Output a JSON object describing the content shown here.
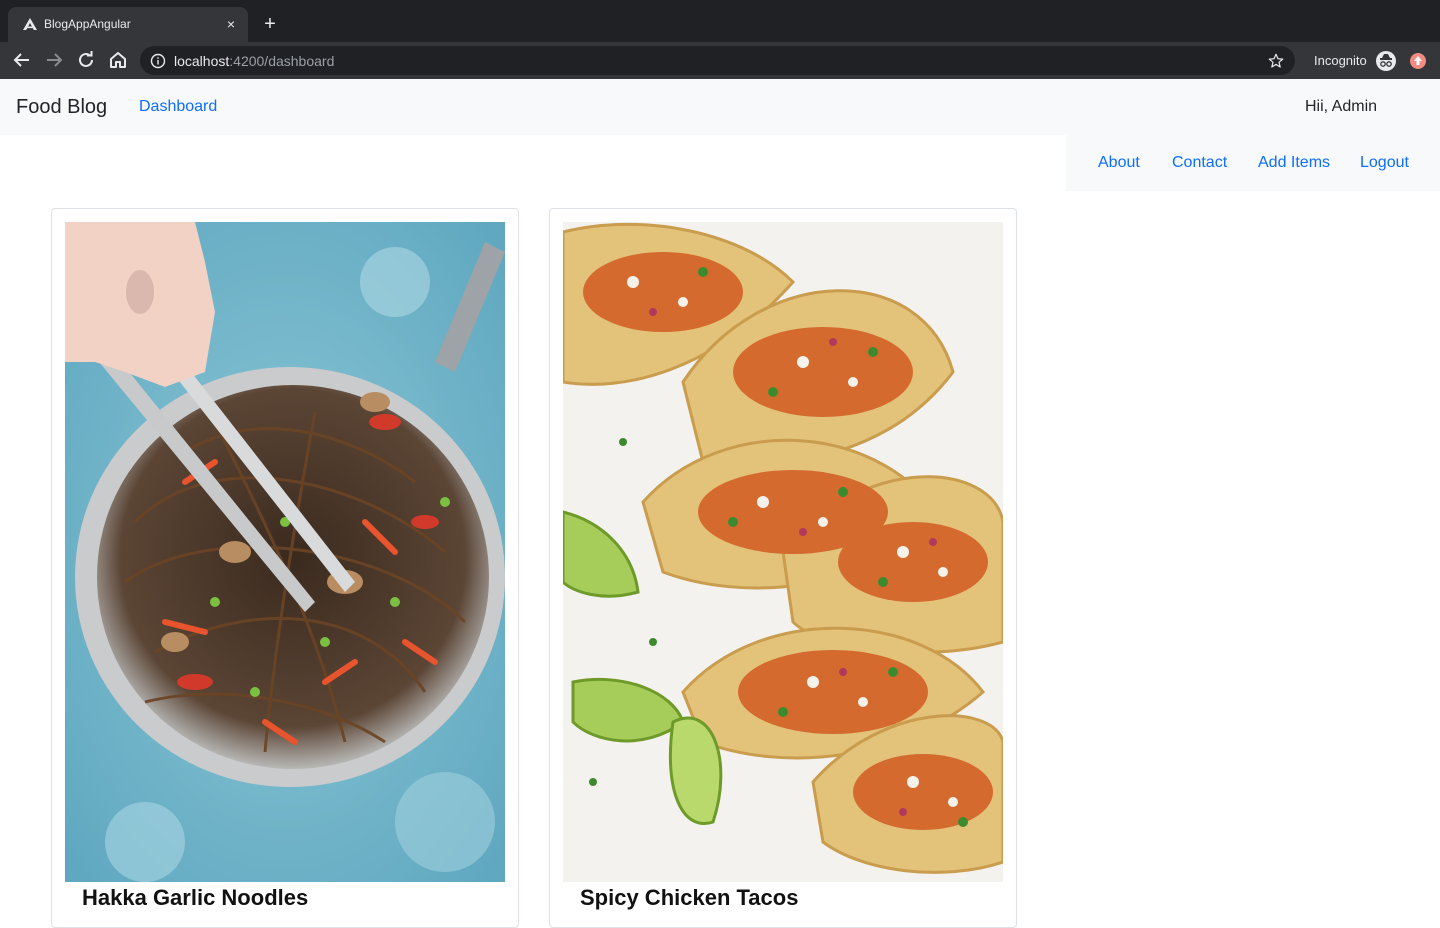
{
  "browser": {
    "tab_title": "BlogAppAngular",
    "tab_close": "×",
    "new_tab": "+",
    "url_host": "localhost",
    "url_path": ":4200/dashboard",
    "incognito_label": "Incognito"
  },
  "navbar": {
    "brand": "Food Blog",
    "dashboard_link": "Dashboard",
    "greeting": "Hii, Admin"
  },
  "subnav": {
    "items": [
      "About",
      "Contact",
      "Add Items",
      "Logout"
    ]
  },
  "cards": [
    {
      "title": "Hakka Garlic Noodles",
      "image": "noodles-pan-photo"
    },
    {
      "title": "Spicy Chicken Tacos",
      "image": "tacos-photo"
    }
  ],
  "colors": {
    "link": "#0d6efd",
    "navbar_bg": "#f8f9fa",
    "chrome_dark": "#202124",
    "chrome_toolbar": "#35363a"
  }
}
